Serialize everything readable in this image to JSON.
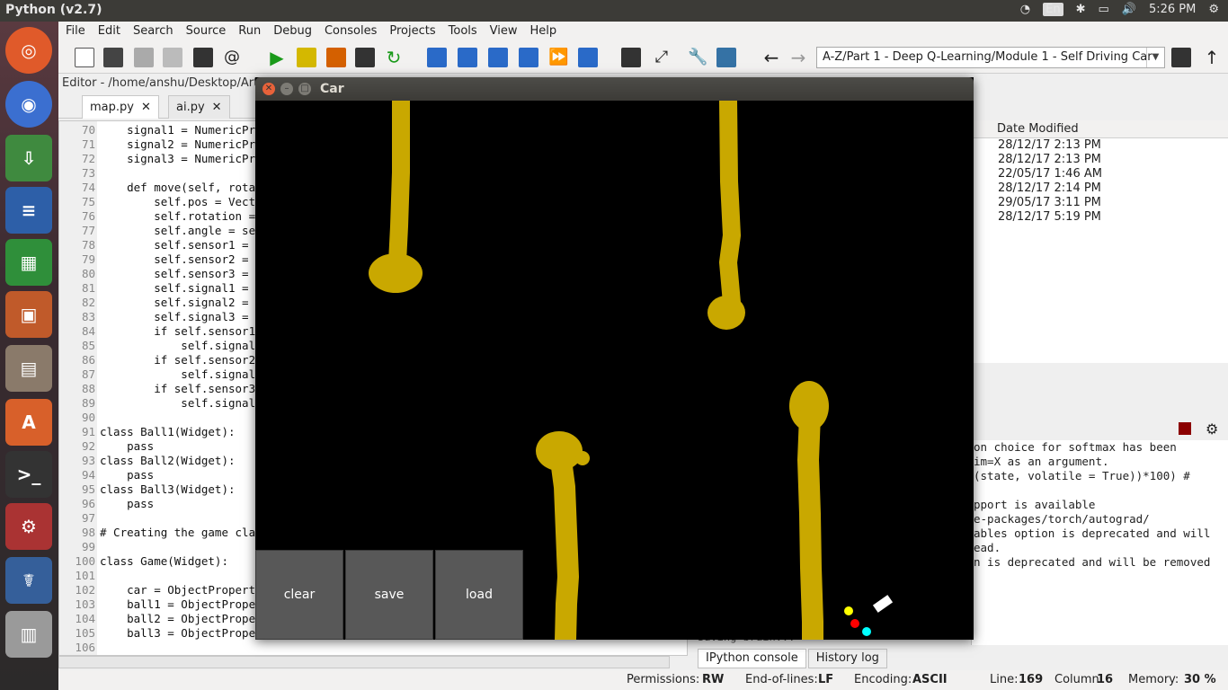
{
  "system": {
    "app_title": "Python (v2.7)",
    "keyboard": "En",
    "time": "5:26 PM"
  },
  "menu": [
    "File",
    "Edit",
    "Search",
    "Source",
    "Run",
    "Debug",
    "Consoles",
    "Projects",
    "Tools",
    "View",
    "Help"
  ],
  "toolbar": {
    "path": "A-Z/Part 1 - Deep Q-Learning/Module 1 - Self Driving Car"
  },
  "editor": {
    "title": "Editor - /home/anshu/Desktop/Artifi",
    "tabs": [
      {
        "label": "map.py"
      },
      {
        "label": "ai.py"
      }
    ],
    "lines": [
      {
        "n": "70",
        "t": "    signal1 = NumericPr"
      },
      {
        "n": "71",
        "t": "    signal2 = NumericPr"
      },
      {
        "n": "72",
        "t": "    signal3 = NumericPr"
      },
      {
        "n": "73",
        "t": ""
      },
      {
        "n": "74",
        "t": "    def move(self, rota"
      },
      {
        "n": "75",
        "t": "        self.pos = Vect"
      },
      {
        "n": "76",
        "t": "        self.rotation ="
      },
      {
        "n": "77",
        "t": "        self.angle = se"
      },
      {
        "n": "78",
        "t": "        self.sensor1 ="
      },
      {
        "n": "79",
        "t": "        self.sensor2 ="
      },
      {
        "n": "80",
        "t": "        self.sensor3 ="
      },
      {
        "n": "81",
        "t": "        self.signal1 ="
      },
      {
        "n": "82",
        "t": "        self.signal2 ="
      },
      {
        "n": "83",
        "t": "        self.signal3 ="
      },
      {
        "n": "84",
        "t": "        if self.sensor1"
      },
      {
        "n": "85",
        "t": "            self.signal"
      },
      {
        "n": "86",
        "t": "        if self.sensor2"
      },
      {
        "n": "87",
        "t": "            self.signal"
      },
      {
        "n": "88",
        "t": "        if self.sensor3"
      },
      {
        "n": "89",
        "t": "            self.signal"
      },
      {
        "n": "90",
        "t": ""
      },
      {
        "n": "91",
        "t": "class Ball1(Widget):"
      },
      {
        "n": "92",
        "t": "    pass"
      },
      {
        "n": "93",
        "t": "class Ball2(Widget):"
      },
      {
        "n": "94",
        "t": "    pass"
      },
      {
        "n": "95",
        "t": "class Ball3(Widget):"
      },
      {
        "n": "96",
        "t": "    pass"
      },
      {
        "n": "97",
        "t": ""
      },
      {
        "n": "98",
        "t": "# Creating the game cla"
      },
      {
        "n": "99",
        "t": ""
      },
      {
        "n": "100",
        "t": "class Game(Widget):"
      },
      {
        "n": "101",
        "t": ""
      },
      {
        "n": "102",
        "t": "    car = ObjectPropert"
      },
      {
        "n": "103",
        "t": "    ball1 = ObjectPrope"
      },
      {
        "n": "104",
        "t": "    ball2 = ObjectPrope"
      },
      {
        "n": "105",
        "t": "    ball3 = ObjectPrope"
      },
      {
        "n": "106",
        "t": ""
      }
    ]
  },
  "files": {
    "header": "Date Modified",
    "rows": [
      "28/12/17 2:13 PM",
      "28/12/17 2:13 PM",
      "22/05/17 1:46 AM",
      "28/12/17 2:14 PM",
      "29/05/17 3:11 PM",
      "28/12/17 5:19 PM"
    ]
  },
  "console": {
    "lines": [
      "on choice for softmax has been",
      "im=X as an argument.",
      "(state, volatile = True))*100) #",
      "",
      "pport is available",
      "e-packages/torch/autograd/",
      "ables option is deprecated and will",
      "ead.",
      "n is deprecated and will be removed"
    ],
    "partial": "Saving brain...",
    "tabs": [
      "IPython console",
      "History log"
    ]
  },
  "status": {
    "permissions_label": "Permissions:",
    "permissions": "RW",
    "eol_label": "End-of-lines:",
    "eol": "LF",
    "encoding_label": "Encoding:",
    "encoding": "ASCII",
    "line_label": "Line:",
    "line": "169",
    "column_label": "Column:",
    "column": "16",
    "memory_label": "Memory:",
    "memory": "30 %"
  },
  "car_window": {
    "title": "Car",
    "buttons": {
      "clear": "clear",
      "save": "save",
      "load": "load"
    }
  },
  "colors": {
    "sand": "#c9a800",
    "ball1": "#ffff00",
    "ball2": "#ff0000",
    "ball3": "#00ffff",
    "car": "#ffffff"
  }
}
